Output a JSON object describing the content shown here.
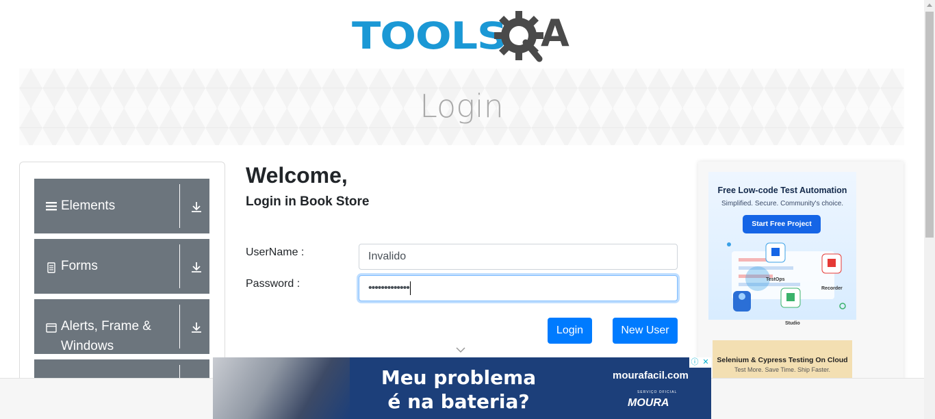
{
  "header": {
    "logo_text": "TOOLS",
    "logo_suffix": "A"
  },
  "banner": {
    "title": "Login"
  },
  "sidebar": {
    "groups": [
      {
        "label": "Elements",
        "icon": "hamburger-icon"
      },
      {
        "label": "Forms",
        "icon": "document-icon"
      },
      {
        "label": "Alerts, Frame & Windows",
        "icon": "window-icon"
      },
      {
        "label": "",
        "icon": "arrow-down-icon"
      }
    ]
  },
  "main": {
    "welcome": "Welcome,",
    "subtitle": "Login in Book Store",
    "username_label": "UserName :",
    "username_value": "Invalido",
    "password_label": "Password :",
    "password_value": "•••••••••••••",
    "login_button": "Login",
    "new_user_button": "New User"
  },
  "ads": {
    "side_ad_title": "Free Low-code Test Automation",
    "side_ad_subtitle": "Simplified. Secure. Community's choice.",
    "side_ad_button": "Start Free Project",
    "side_ad_tags": [
      "TestOps",
      "Recorder",
      "Studio"
    ],
    "side_ad2_title": "Selenium & Cypress Testing On Cloud",
    "side_ad2_subtitle": "Test More. Save Time. Ship Faster.",
    "bottom_ad_headline": "Meu problema é na bateria?",
    "bottom_ad_brand": "mourafacil.com",
    "bottom_ad_small": "SERVIÇO OFICIAL",
    "bottom_ad_logo": "MOURA"
  },
  "colors": {
    "primary": "#007bff",
    "sidebar_group": "#6c757d",
    "logo_blue": "#1b98d5",
    "logo_dark": "#4a4a4a"
  }
}
